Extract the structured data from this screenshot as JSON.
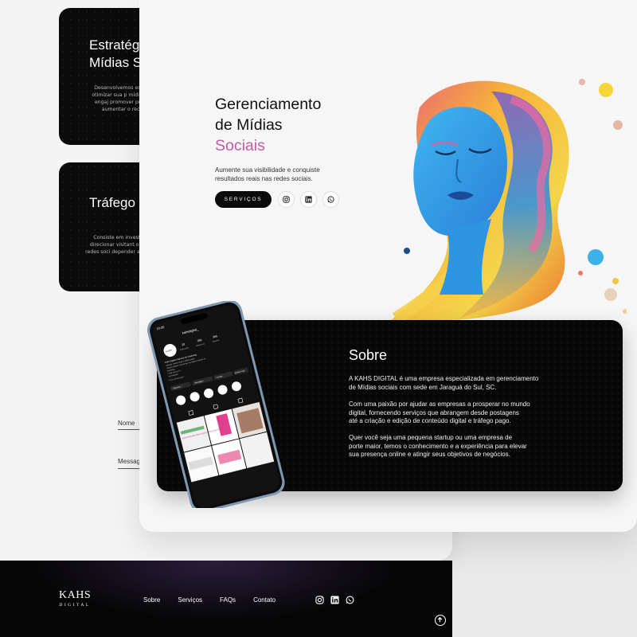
{
  "back_page": {
    "cards": [
      {
        "title": "Estratégia\nMídias So",
        "desc": "Desenvolvemos estrat para otimizar sua p mídias sociais, engaj promover produtos e aumentar o reconhec"
      },
      {
        "title": "Tráfego I",
        "desc": "Consiste em investir er para direcionar visitant ou perfil nas redes soci depender apenas do trá"
      }
    ],
    "form": {
      "name_label": "Nome",
      "message_label": "Messag"
    }
  },
  "footer": {
    "logo": "KAHS",
    "logo_sub": "DIGITAL",
    "nav": [
      "Sobre",
      "Serviços",
      "FAQs",
      "Contato"
    ],
    "social_icons": [
      "instagram-icon",
      "linkedin-icon",
      "whatsapp-icon"
    ]
  },
  "hero": {
    "title_line1": "Gerenciamento",
    "title_line2": "de Mídias",
    "title_accent": "Sociais",
    "subtitle": "Aumente sua visibilidade e conquiste resultados reais nas redes sociais.",
    "button": "SERVIÇOS",
    "social_icons": [
      "instagram-icon",
      "linkedin-icon",
      "whatsapp-icon"
    ]
  },
  "about": {
    "title": "Sobre",
    "p1": "A KAHS DIGITAL é uma empresa especializada em gerenciamento\nde Mídias sociais com sede em Jaraguá do Sul, SC.",
    "p2": "Com uma paixão por ajudar as empresas a prosperar no mundo\ndigital, fornecendo serviços que abrangem desde postagens\naté a criação e edição de conteúdo digital e tráfego pago.",
    "p3": "Quer você seja uma pequena startup ou uma empresa de\nporte maior, temos o conhecimento e a experiência para elevar\nsua presença online e atingir seus objetivos de negócios."
  },
  "phone": {
    "time": "10:35",
    "username": "kahsdigital_",
    "avatar_text": "KAHS",
    "stats": [
      {
        "num": "20",
        "label": "Publicações"
      },
      {
        "num": "389",
        "label": "Seguidores"
      },
      {
        "num": "366",
        "label": "Seguindo"
      }
    ],
    "bio_name": "Kahs Digital | Agência de marketing",
    "bio_lines": [
      "• Design, redes sociais e tráfego pago.",
      "• Nosso objetivo é alavancar seu negócio através do",
      "marketing.",
      "• Fale conosco! 📞",
      "Ver tradução"
    ],
    "link": "linktr.ee/kahsdigital",
    "buttons": [
      "Seguindo ⌄",
      "Mensagem",
      "Contato",
      "Sorteio mais"
    ],
    "post_text": "ESTRATÉGIAS PARA AUMENTAR SUAS VENDAS"
  },
  "colors": {
    "accent": "#c25aa8",
    "dark": "#070707"
  }
}
